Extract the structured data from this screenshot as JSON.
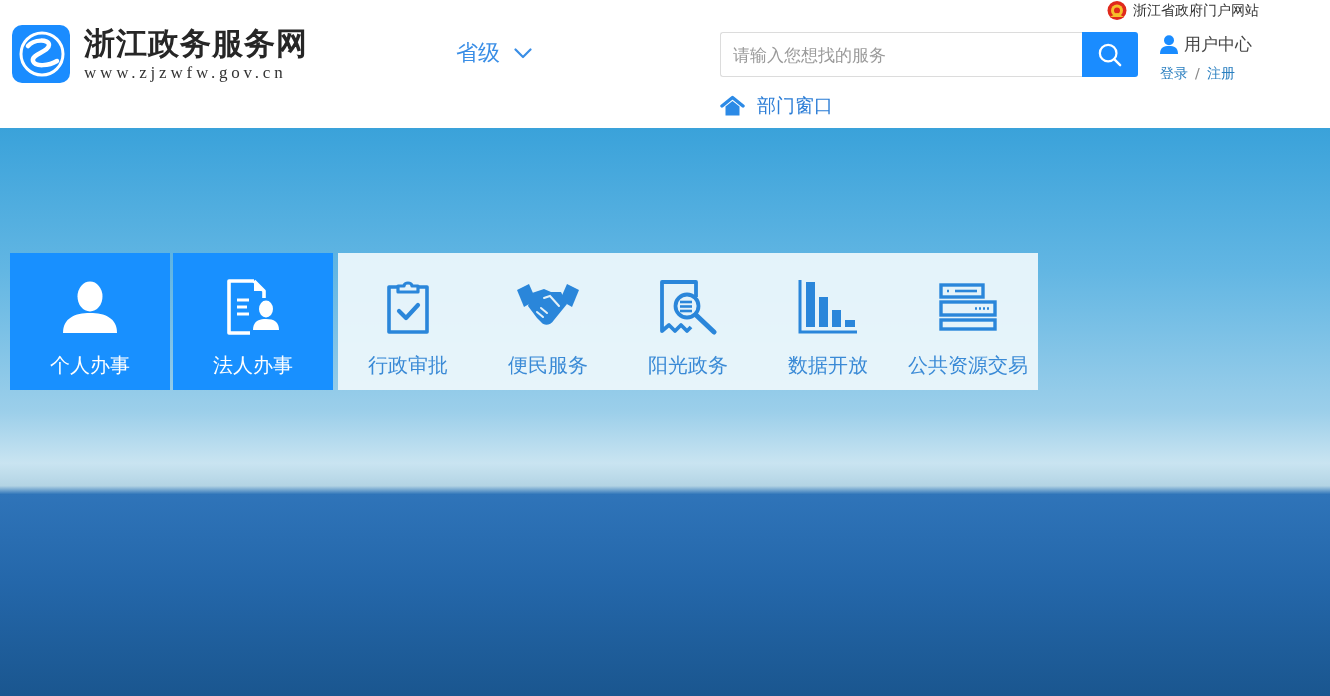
{
  "header": {
    "logo": {
      "title": "浙江政务服务网",
      "url": "www.zjzwfw.gov.cn"
    },
    "region_selector": {
      "label": "省级"
    },
    "portal_link": {
      "label": "浙江省政府门户网站"
    },
    "search": {
      "placeholder": "请输入您想找的服务"
    },
    "user_center": {
      "title": "用户中心",
      "login": "登录",
      "separator": "/",
      "register": "注册"
    },
    "department_link": {
      "label": "部门窗口"
    }
  },
  "services": [
    {
      "label": "个人办事",
      "kind": "primary"
    },
    {
      "label": "法人办事",
      "kind": "primary"
    },
    {
      "label": "行政审批",
      "kind": "secondary"
    },
    {
      "label": "便民服务",
      "kind": "secondary"
    },
    {
      "label": "阳光政务",
      "kind": "secondary"
    },
    {
      "label": "数据开放",
      "kind": "secondary"
    },
    {
      "label": "公共资源交易",
      "kind": "secondary"
    }
  ]
}
